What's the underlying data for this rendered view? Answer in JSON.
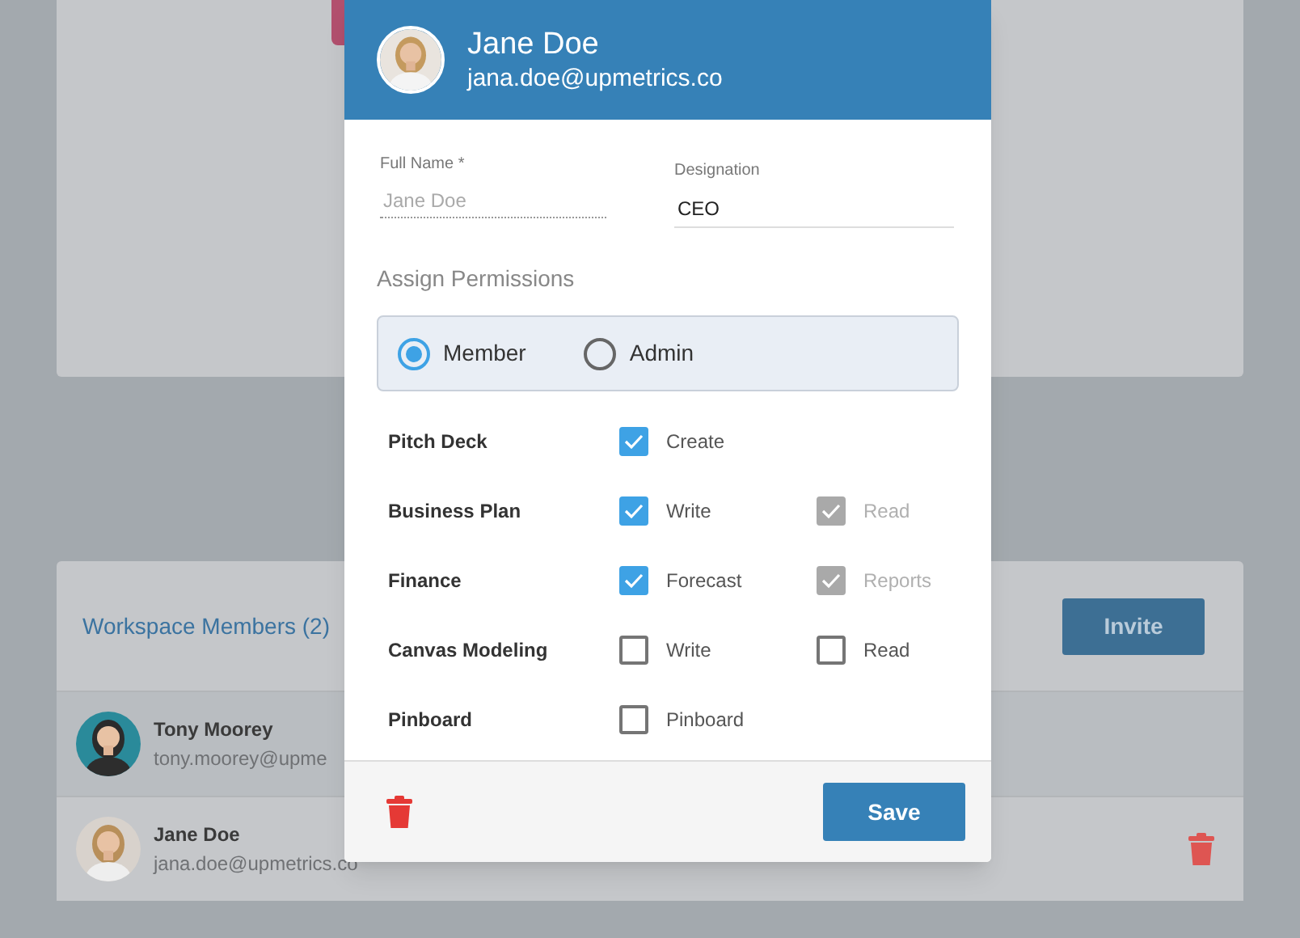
{
  "members_card": {
    "title": "Workspace Members (2)",
    "invite_button": "Invite",
    "members": [
      {
        "name": "Tony Moorey",
        "email": "tony.moorey@upme",
        "selected": true
      },
      {
        "name": "Jane Doe",
        "email": "jana.doe@upmetrics.co",
        "selected": false
      }
    ]
  },
  "modal": {
    "name": "Jane Doe",
    "email": "jana.doe@upmetrics.co",
    "full_name": {
      "label": "Full Name *",
      "placeholder": "Jane Doe"
    },
    "designation": {
      "label": "Designation",
      "value": "CEO"
    },
    "section_title": "Assign Permissions",
    "roles": [
      {
        "label": "Member",
        "selected": true
      },
      {
        "label": "Admin",
        "selected": false
      }
    ],
    "permissions": [
      {
        "label": "Pitch Deck",
        "options": [
          {
            "label": "Create",
            "checked": true,
            "disabled": false
          }
        ]
      },
      {
        "label": "Business Plan",
        "options": [
          {
            "label": "Write",
            "checked": true,
            "disabled": false
          },
          {
            "label": "Read",
            "checked": true,
            "disabled": true
          }
        ]
      },
      {
        "label": "Finance",
        "options": [
          {
            "label": "Forecast",
            "checked": true,
            "disabled": false
          },
          {
            "label": "Reports",
            "checked": true,
            "disabled": true
          }
        ]
      },
      {
        "label": "Canvas Modeling",
        "options": [
          {
            "label": "Write",
            "checked": false,
            "disabled": false
          },
          {
            "label": "Read",
            "checked": false,
            "disabled": false
          }
        ]
      },
      {
        "label": "Pinboard",
        "options": [
          {
            "label": "Pinboard",
            "checked": false,
            "disabled": false
          }
        ]
      }
    ],
    "save_button": "Save"
  }
}
